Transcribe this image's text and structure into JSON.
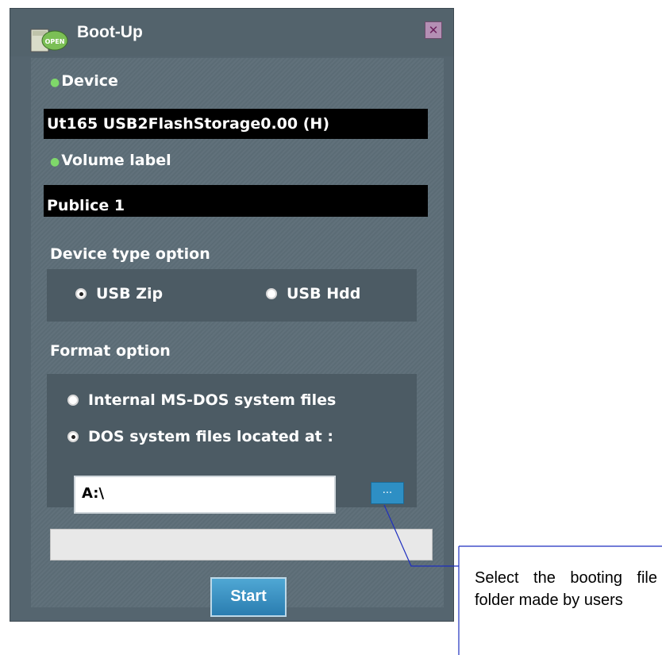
{
  "window": {
    "title": "Boot-Up",
    "close_label": "✕"
  },
  "device": {
    "label": "Device",
    "value": "Ut165  USB2FlashStorage0.00  (H)"
  },
  "volume": {
    "label": "Volume label",
    "value": "Publice 1"
  },
  "device_type": {
    "label": "Device type option",
    "options": [
      {
        "label": "USB Zip",
        "selected": true
      },
      {
        "label": "USB Hdd",
        "selected": false
      }
    ]
  },
  "format": {
    "label": "Format option",
    "options": [
      {
        "label": "Internal MS-DOS system files",
        "selected": false
      },
      {
        "label": "DOS system files located at :",
        "selected": true
      }
    ],
    "path_value": "A:\\",
    "browse_label": "..."
  },
  "start_label": "Start",
  "callout": {
    "text": "Select the booting file folder made by users"
  },
  "icons": {
    "app": "drive-open-icon",
    "close": "close-icon"
  },
  "colors": {
    "panel": "#5d6e78",
    "accent": "#2e8fc4",
    "bullet": "#7fd86a"
  }
}
